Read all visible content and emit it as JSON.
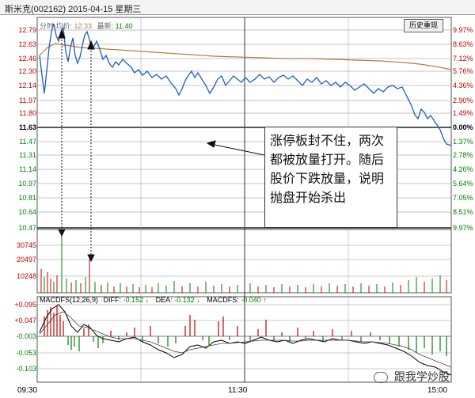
{
  "header": {
    "title": "斯米克(002162) 2015-04-15 星期三"
  },
  "price_panel": {
    "legend_prefix": "分时 均价:",
    "avg_price": "12.33",
    "latest_label": "最新:",
    "latest_price": "11.40",
    "history_button": "历史重现",
    "left_labels": [
      "12.79",
      "12.63",
      "12.46",
      "12.30",
      "12.14",
      "11.97",
      "11.80",
      "11.63",
      "11.47",
      "11.31",
      "11.14",
      "10.97",
      "10.81",
      "10.64",
      "10.47"
    ],
    "right_labels": [
      "9.97%",
      "8.63%",
      "7.12%",
      "5.76%",
      "4.36%",
      "2.90%",
      "1.49%",
      "0.00%",
      "1.37%",
      "2.78%",
      "4.26%",
      "5.64%",
      "7.05%",
      "8.51%",
      "9.97%"
    ]
  },
  "volume_panel": {
    "labels": [
      "30745",
      "20497",
      "10248"
    ]
  },
  "macd_panel": {
    "legend_name": "MACDFS(12,26,9)",
    "diff_label": "DIFF:",
    "diff_value": "-0.152",
    "dea_label": "DEA:",
    "dea_value": "-0.132",
    "macdfs_label": "MACDFS:",
    "macdfs_value": "-0.040",
    "labels": [
      "+0.095",
      "+0.047",
      "-0.003",
      "-0.053",
      "-0.103"
    ]
  },
  "time_axis": {
    "start": "09:30",
    "mid": "11:30",
    "end": "15:00"
  },
  "annotation": {
    "text": "涨停板封不住，两次都被放量打开。随后股价下跌放量，说明抛盘开始杀出"
  },
  "watermark": {
    "text": "跟我学炒股"
  },
  "colors": {
    "price_line": "#1f5fbf",
    "avg_line": "#b08040",
    "up_red": "#c00000",
    "down_green": "#008000",
    "grid": "#444444"
  }
}
